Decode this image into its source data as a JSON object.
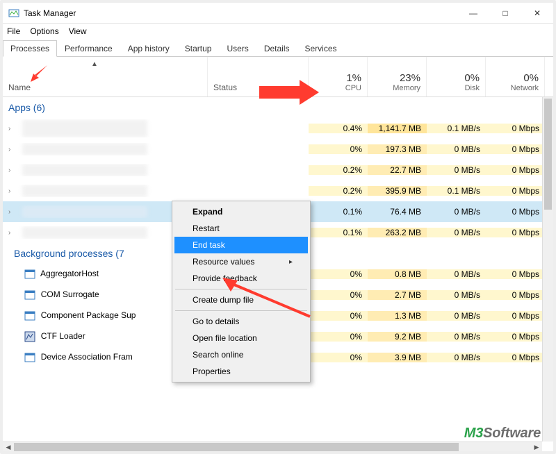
{
  "window": {
    "title": "Task Manager"
  },
  "menu": {
    "file": "File",
    "options": "Options",
    "view": "View"
  },
  "tabs": {
    "processes": "Processes",
    "performance": "Performance",
    "app_history": "App history",
    "startup": "Startup",
    "users": "Users",
    "details": "Details",
    "services": "Services"
  },
  "columns": {
    "name": "Name",
    "status": "Status",
    "cpu_pct": "1%",
    "cpu_label": "CPU",
    "mem_pct": "23%",
    "mem_label": "Memory",
    "disk_pct": "0%",
    "disk_label": "Disk",
    "net_pct": "0%",
    "net_label": "Network"
  },
  "groups": {
    "apps": "Apps (6)",
    "bg": "Background processes (7"
  },
  "rows": {
    "apps": [
      {
        "blurred": true,
        "cpu": "0.4%",
        "mem": "1,141.7 MB",
        "disk": "0.1 MB/s",
        "net": "0 Mbps"
      },
      {
        "blurred": true,
        "cpu": "0%",
        "mem": "197.3 MB",
        "disk": "0 MB/s",
        "net": "0 Mbps"
      },
      {
        "blurred": true,
        "cpu": "0.2%",
        "mem": "22.7 MB",
        "disk": "0 MB/s",
        "net": "0 Mbps"
      },
      {
        "blurred": true,
        "cpu": "0.2%",
        "mem": "395.9 MB",
        "disk": "0.1 MB/s",
        "net": "0 Mbps"
      },
      {
        "blurred": true,
        "cpu": "0.1%",
        "mem": "76.4 MB",
        "disk": "0 MB/s",
        "net": "0 Mbps",
        "selected": true
      },
      {
        "blurred": true,
        "cpu": "0.1%",
        "mem": "263.2 MB",
        "disk": "0 MB/s",
        "net": "0 Mbps"
      }
    ],
    "bg": [
      {
        "name": "AggregatorHost",
        "cpu": "0%",
        "mem": "0.8 MB",
        "disk": "0 MB/s",
        "net": "0 Mbps"
      },
      {
        "name": "COM Surrogate",
        "cpu": "0%",
        "mem": "2.7 MB",
        "disk": "0 MB/s",
        "net": "0 Mbps"
      },
      {
        "name": "Component Package Sup",
        "cpu": "0%",
        "mem": "1.3 MB",
        "disk": "0 MB/s",
        "net": "0 Mbps"
      },
      {
        "name": "CTF Loader",
        "cpu": "0%",
        "mem": "9.2 MB",
        "disk": "0 MB/s",
        "net": "0 Mbps"
      },
      {
        "name": "Device Association Fram",
        "cpu": "0%",
        "mem": "3.9 MB",
        "disk": "0 MB/s",
        "net": "0 Mbps"
      }
    ]
  },
  "context_menu": {
    "expand": "Expand",
    "restart": "Restart",
    "end_task": "End task",
    "resource_values": "Resource values",
    "provide_feedback": "Provide feedback",
    "create_dump": "Create dump file",
    "go_to_details": "Go to details",
    "open_file_location": "Open file location",
    "search_online": "Search online",
    "properties": "Properties"
  },
  "watermark": {
    "left": "M3",
    "right": "Software"
  }
}
